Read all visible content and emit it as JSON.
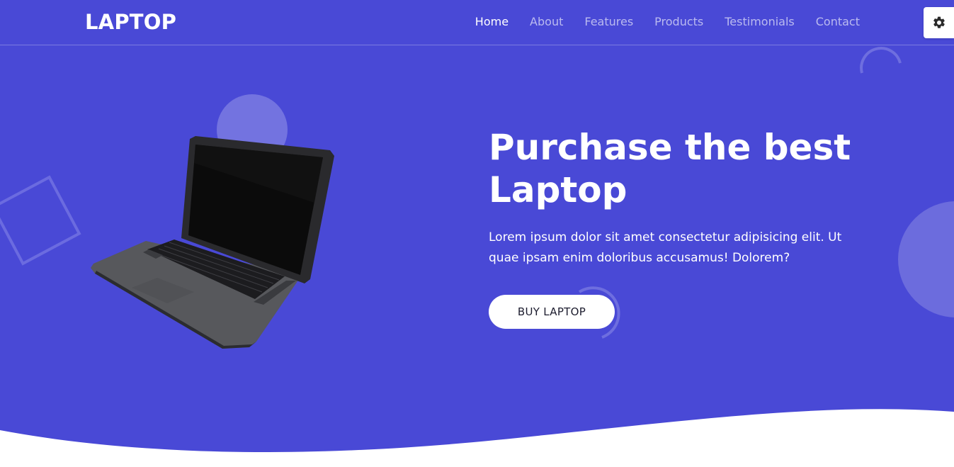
{
  "header": {
    "logo": "LAPTOP",
    "nav": [
      {
        "label": "Home",
        "active": true
      },
      {
        "label": "About",
        "active": false
      },
      {
        "label": "Features",
        "active": false
      },
      {
        "label": "Products",
        "active": false
      },
      {
        "label": "Testimonials",
        "active": false
      },
      {
        "label": "Contact",
        "active": false
      }
    ],
    "settings_icon": "gear-icon"
  },
  "hero": {
    "title_line1": "Purchase the best",
    "title_line2": "Laptop",
    "description_line1": "Lorem ipsum dolor sit amet consectetur adipisicing elit. Ut",
    "description_line2": "quae ipsam enim doloribus accusamus! Dolorem?",
    "cta_label": "BUY LAPTOP",
    "image": "laptop-image"
  },
  "colors": {
    "background": "#4949d6",
    "header_text": "#ffffff",
    "nav_inactive": "rgba(255,255,255,0.62)",
    "button_bg": "#ffffff",
    "wave": "#ffffff"
  }
}
